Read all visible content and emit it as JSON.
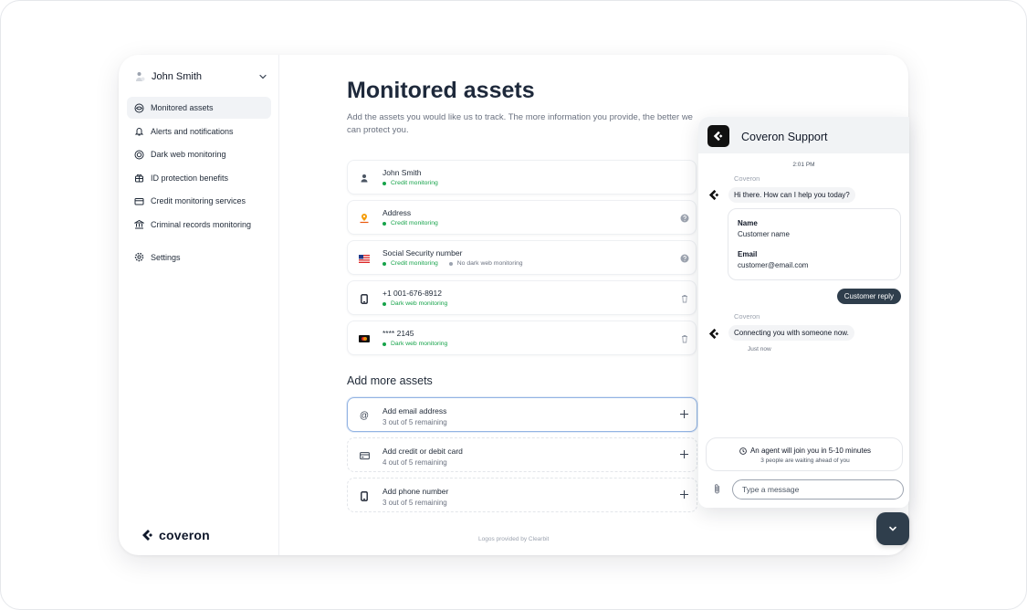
{
  "user": {
    "name": "John Smith"
  },
  "nav": {
    "items": [
      {
        "label": "Monitored assets",
        "icon": "shield-eye-icon",
        "active": true
      },
      {
        "label": "Alerts and notifications",
        "icon": "bell-icon"
      },
      {
        "label": "Dark web monitoring",
        "icon": "globe-icon"
      },
      {
        "label": "ID protection benefits",
        "icon": "gift-icon"
      },
      {
        "label": "Credit monitoring services",
        "icon": "credit-card-icon"
      },
      {
        "label": "Criminal records monitoring",
        "icon": "building-icon"
      }
    ],
    "settings_label": "Settings"
  },
  "brand": {
    "name": "coveron"
  },
  "main": {
    "title": "Monitored assets",
    "description": "Add the assets you would like us to track. The more information you provide, the better we can protect you.",
    "assets": [
      {
        "title": "John Smith",
        "statuses": [
          {
            "text": "Credit monitoring",
            "color": "#16a34a"
          }
        ],
        "right_icon": "none",
        "icon": "person-icon"
      },
      {
        "title": "Address",
        "statuses": [
          {
            "text": "Credit monitoring",
            "color": "#16a34a"
          }
        ],
        "right_icon": "help-icon",
        "icon": "location-icon"
      },
      {
        "title": "Social Security number",
        "statuses": [
          {
            "text": "Credit monitoring",
            "color": "#16a34a"
          },
          {
            "text": "No dark web monitoring",
            "color": "#6b7280"
          }
        ],
        "right_icon": "help-icon",
        "icon": "us-flag-icon"
      },
      {
        "title": "+1 001-676-8912",
        "statuses": [
          {
            "text": "Dark web monitoring",
            "color": "#16a34a"
          }
        ],
        "right_icon": "trash-icon",
        "icon": "phone-icon"
      },
      {
        "title": "**** 2145",
        "statuses": [
          {
            "text": "Dark web monitoring",
            "color": "#16a34a"
          }
        ],
        "right_icon": "trash-icon",
        "icon": "mastercard-icon"
      }
    ],
    "add_title": "Add more assets",
    "add_items": [
      {
        "title": "Add email address",
        "sub": "3 out of 5 remaining",
        "icon": "at-icon",
        "focused": true
      },
      {
        "title": "Add credit or debit card",
        "sub": "4 out of 5 remaining",
        "icon": "card-icon",
        "focused": false
      },
      {
        "title": "Add phone number",
        "sub": "3 out of 5 remaining",
        "icon": "phone-icon",
        "focused": false
      }
    ],
    "footer": "Logos provided by Clearbit"
  },
  "chat": {
    "title": "Coveron Support",
    "time": "2:01 PM",
    "sender": "Coveron",
    "greeting": "Hi there. How can I help you today?",
    "form": {
      "name_label": "Name",
      "name_value": "Customer name",
      "email_label": "Email",
      "email_value": "customer@email.com"
    },
    "reply": "Customer reply",
    "connecting": "Connecting you with someone now.",
    "just_now": "Just now",
    "agent_line": "An agent will join you in 5-10 minutes",
    "queue_line": "3 people are waiting ahead of you",
    "input_placeholder": "Type a message"
  },
  "colors": {
    "accent": "#2f3e4c",
    "success": "#16a34a",
    "focus": "#93b4e3"
  }
}
